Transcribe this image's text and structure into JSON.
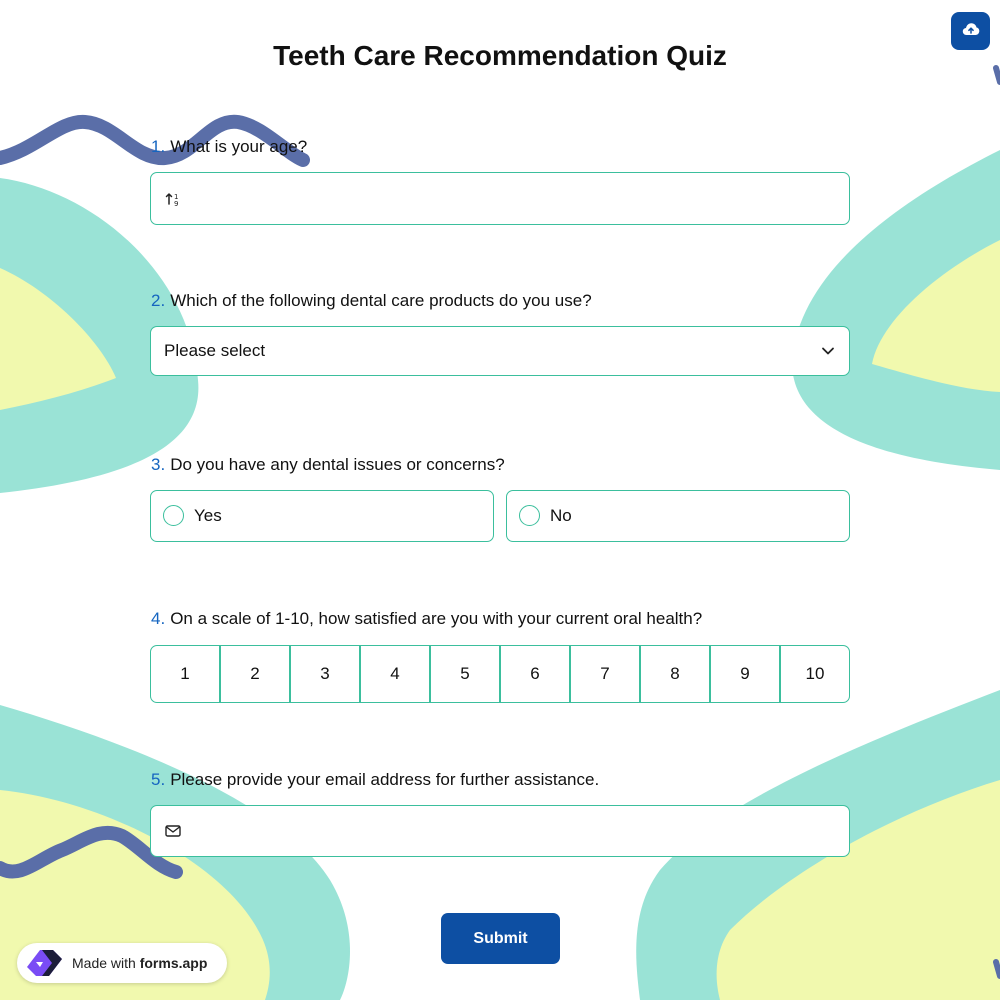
{
  "form": {
    "title": "Teeth Care Recommendation Quiz",
    "submit_label": "Submit"
  },
  "questions": [
    {
      "number": "1.",
      "label": "What is your age?",
      "type": "number",
      "icon": "number-sort-icon"
    },
    {
      "number": "2.",
      "label": "Which of the following dental care products do you use?",
      "type": "select",
      "value": "Please select",
      "icon": "chevron-down-icon"
    },
    {
      "number": "3.",
      "label": "Do you have any dental issues or concerns?",
      "type": "radio",
      "options": [
        "Yes",
        "No"
      ]
    },
    {
      "number": "4.",
      "label": "On a scale of 1-10, how satisfied are you with your current oral health?",
      "type": "scale",
      "options": [
        "1",
        "2",
        "3",
        "4",
        "5",
        "6",
        "7",
        "8",
        "9",
        "10"
      ]
    },
    {
      "number": "5.",
      "label": "Please provide your email address for further assistance.",
      "type": "email",
      "icon": "envelope-icon"
    }
  ],
  "badge": {
    "prefix": "Made with",
    "brand": "forms.app"
  },
  "toolbar": {
    "upload_icon": "cloud-upload-icon"
  },
  "colors": {
    "accent": "#0d4fa3",
    "border": "#3bbf9d",
    "number": "#1565c0",
    "blob_teal": "#9ae3d6",
    "blob_yellow": "#f1f9ae",
    "squiggle": "#5a6ea8"
  }
}
